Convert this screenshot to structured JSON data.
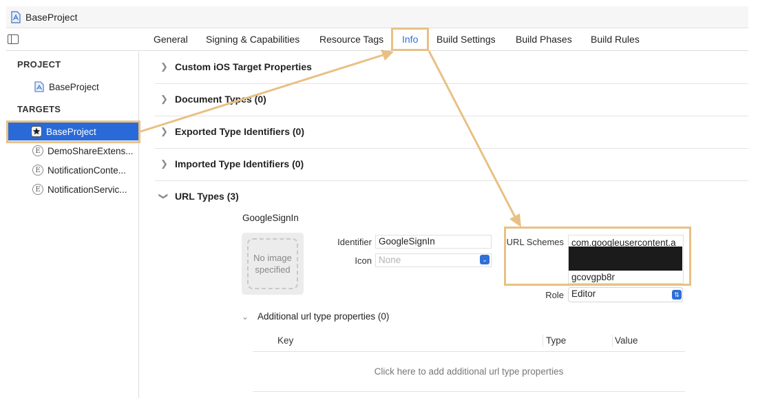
{
  "window": {
    "title": "BaseProject"
  },
  "tabs": [
    {
      "label": "General"
    },
    {
      "label": "Signing & Capabilities"
    },
    {
      "label": "Resource Tags"
    },
    {
      "label": "Info",
      "active": true
    },
    {
      "label": "Build Settings"
    },
    {
      "label": "Build Phases"
    },
    {
      "label": "Build Rules"
    }
  ],
  "sidebar": {
    "project_header": "PROJECT",
    "project_item": "BaseProject",
    "targets_header": "TARGETS",
    "targets": [
      {
        "label": "BaseProject",
        "selected": true
      },
      {
        "label": "DemoShareExtens..."
      },
      {
        "label": "NotificationConte..."
      },
      {
        "label": "NotificationServic..."
      }
    ],
    "extension_glyph": "E"
  },
  "sections": [
    {
      "label": "Custom iOS Target Properties",
      "expanded": false
    },
    {
      "label": "Document Types (0)",
      "expanded": false
    },
    {
      "label": "Exported Type Identifiers (0)",
      "expanded": false
    },
    {
      "label": "Imported Type Identifiers (0)",
      "expanded": false
    },
    {
      "label": "URL Types (3)",
      "expanded": true
    }
  ],
  "url_type": {
    "name": "GoogleSignIn",
    "image_placeholder": "No image specified",
    "identifier_label": "Identifier",
    "identifier_value": "GoogleSignIn",
    "icon_label": "Icon",
    "icon_value": "None",
    "schemes_label": "URL Schemes",
    "schemes_line1": "com.googleusercontent.a",
    "schemes_line3": "gcovgpb8r",
    "role_label": "Role",
    "role_value": "Editor"
  },
  "additional": {
    "label": "Additional url type properties (0)",
    "columns": [
      "Key",
      "Type",
      "Value"
    ],
    "empty_text": "Click here to add additional url type properties"
  },
  "colors": {
    "accent": "#2f6fd6",
    "selection": "#2a6ad8",
    "annotation": "#e8c084",
    "redaction": "#1b1b1b"
  }
}
